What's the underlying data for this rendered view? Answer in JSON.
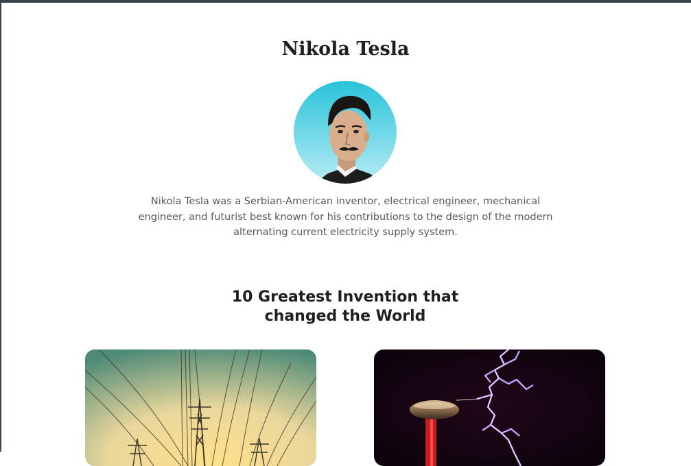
{
  "profile": {
    "name": "Nikola Tesla",
    "bio": "Nikola Tesla was a Serbian-American inventor, electrical engineer, mechanical engineer, and futurist best known for his contributions to the design of the modern alternating current electricity supply system."
  },
  "inventions": {
    "heading_line1": "10 Greatest Invention that",
    "heading_line2": "changed the World"
  }
}
